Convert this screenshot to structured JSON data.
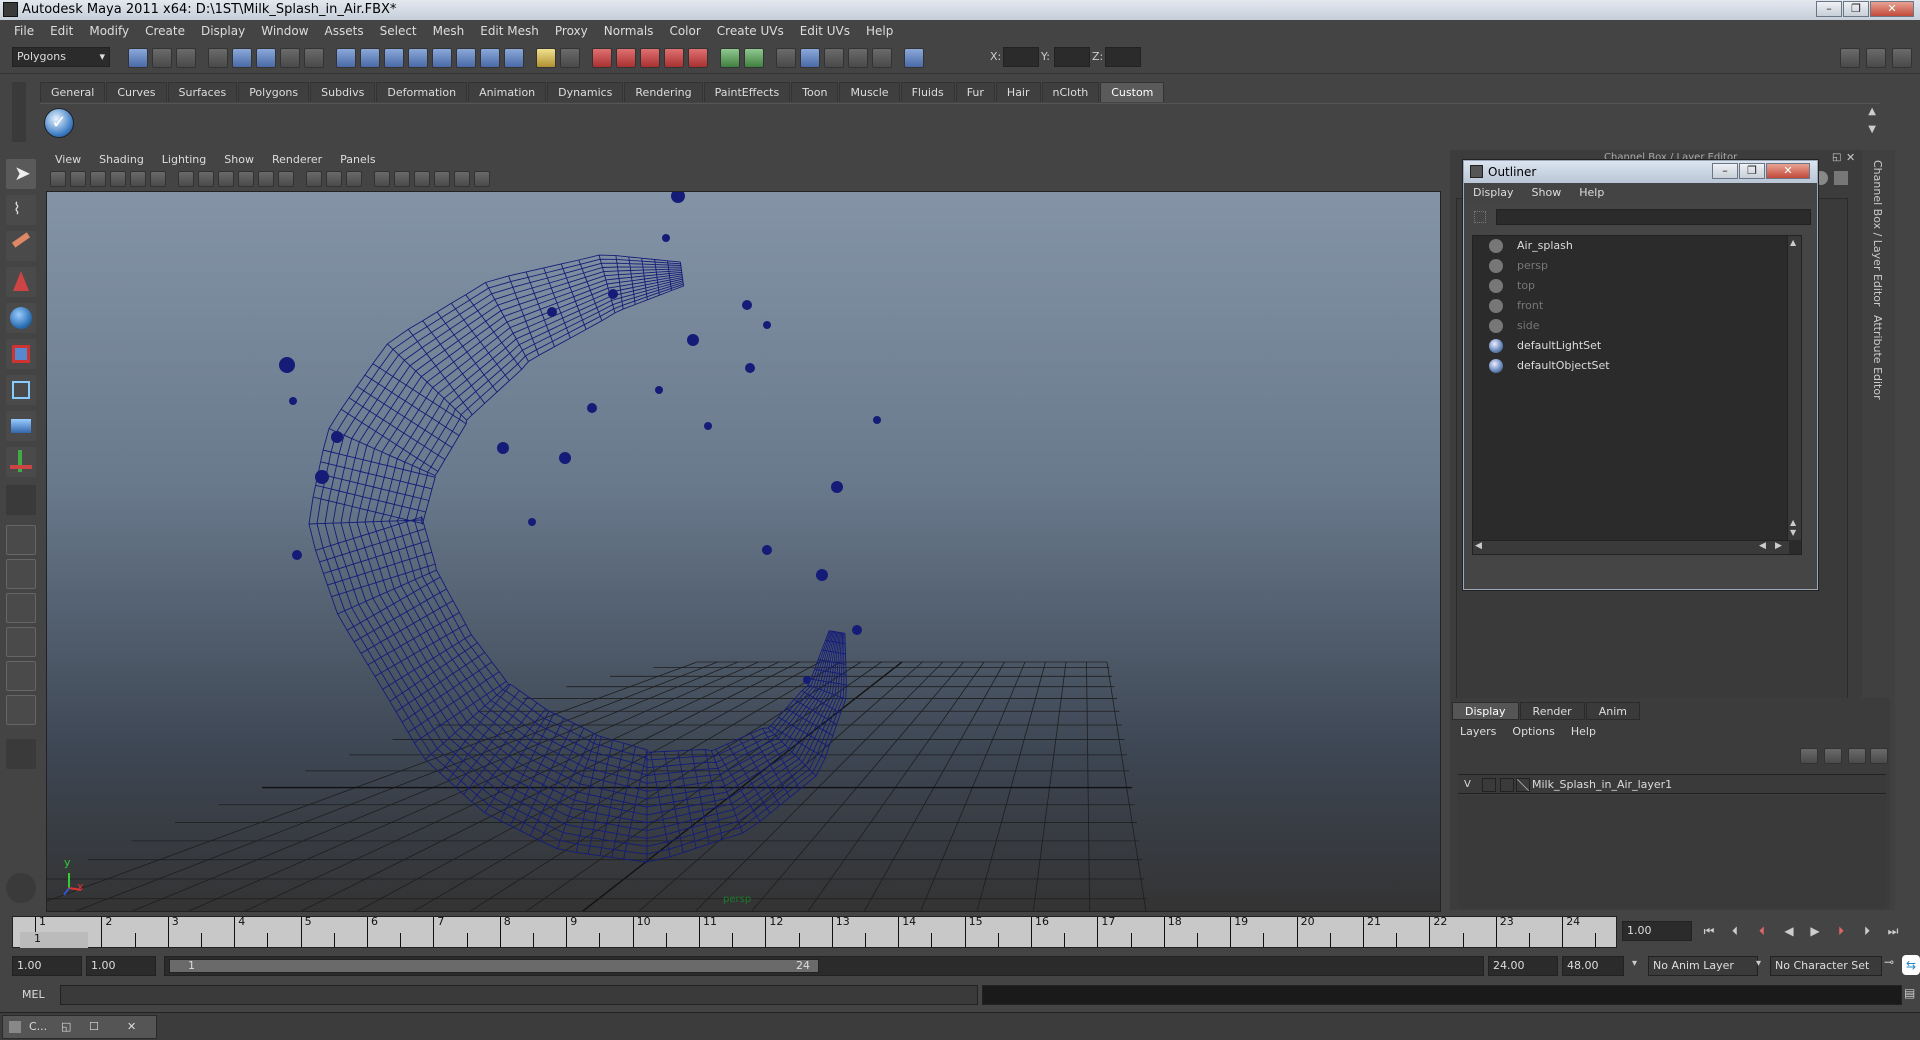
{
  "window": {
    "title": "Autodesk Maya 2011 x64: D:\\1ST\\Milk_Splash_in_Air.FBX*"
  },
  "menubar": [
    "File",
    "Edit",
    "Modify",
    "Create",
    "Display",
    "Window",
    "Assets",
    "Select",
    "Mesh",
    "Edit Mesh",
    "Proxy",
    "Normals",
    "Color",
    "Create UVs",
    "Edit UVs",
    "Help"
  ],
  "status_line": {
    "menu_set": "Polygons",
    "x_label": "X:",
    "y_label": "Y:",
    "z_label": "Z:"
  },
  "shelf": {
    "tabs": [
      "General",
      "Curves",
      "Surfaces",
      "Polygons",
      "Subdivs",
      "Deformation",
      "Animation",
      "Dynamics",
      "Rendering",
      "PaintEffects",
      "Toon",
      "Muscle",
      "Fluids",
      "Fur",
      "Hair",
      "nCloth",
      "Custom"
    ],
    "active_tab": "Custom"
  },
  "viewport": {
    "menu": [
      "View",
      "Shading",
      "Lighting",
      "Show",
      "Renderer",
      "Panels"
    ],
    "camera_label": "persp",
    "axis_y": "y",
    "axis_x": "x",
    "wire_color": "#141c78"
  },
  "right_panel": {
    "header": "Channel Box / Layer Editor",
    "side_tabs": [
      "Channel Box / Layer Editor",
      "Attribute Editor"
    ]
  },
  "outliner": {
    "title": "Outliner",
    "menu": [
      "Display",
      "Show",
      "Help"
    ],
    "items": [
      {
        "label": "Air_splash",
        "icon": "mesh-icon",
        "dim": false
      },
      {
        "label": "persp",
        "icon": "camera-icon",
        "dim": true
      },
      {
        "label": "top",
        "icon": "camera-icon",
        "dim": true
      },
      {
        "label": "front",
        "icon": "camera-icon",
        "dim": true
      },
      {
        "label": "side",
        "icon": "camera-icon",
        "dim": true
      },
      {
        "label": "defaultLightSet",
        "icon": "set-icon",
        "dim": false
      },
      {
        "label": "defaultObjectSet",
        "icon": "set-icon",
        "dim": false
      }
    ]
  },
  "layer_editor": {
    "tabs": [
      "Display",
      "Render",
      "Anim"
    ],
    "active_tab": "Display",
    "menu": [
      "Layers",
      "Options",
      "Help"
    ],
    "layer": {
      "visible": "V",
      "name": "Milk_Splash_in_Air_layer1"
    }
  },
  "time_slider": {
    "ticks": [
      "1",
      "2",
      "3",
      "4",
      "5",
      "6",
      "7",
      "8",
      "9",
      "10",
      "11",
      "12",
      "13",
      "14",
      "15",
      "16",
      "17",
      "18",
      "19",
      "20",
      "21",
      "22",
      "23",
      "24"
    ],
    "current_frame_marker": "1",
    "current_time": "1.00"
  },
  "range_slider": {
    "start_time": "1.00",
    "playback_start": "1.00",
    "range_left": "1",
    "range_right": "24",
    "playback_end": "24.00",
    "end_time": "48.00",
    "anim_layer": "No Anim Layer",
    "character_set": "No Character Set"
  },
  "command_line": {
    "label": "MEL"
  },
  "taskbar": {
    "item": "C..."
  }
}
